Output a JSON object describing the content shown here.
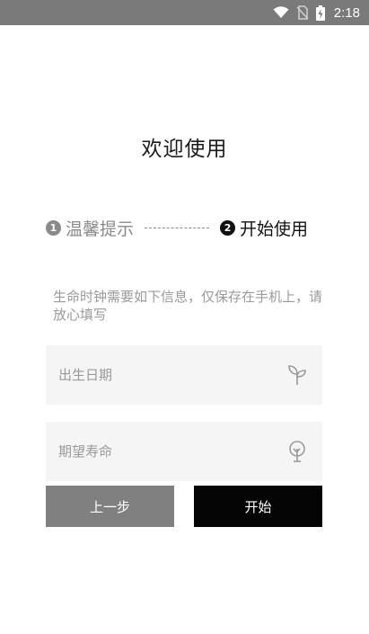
{
  "status_bar": {
    "time": "2:18",
    "icons": [
      "wifi-icon",
      "no-sim-icon",
      "battery-charging-icon"
    ]
  },
  "page": {
    "title": "欢迎使用"
  },
  "steps": [
    {
      "number": "1",
      "label": "温馨提示"
    },
    {
      "number": "2",
      "label": "开始使用"
    }
  ],
  "note": "生命时钟需要如下信息，仅保存在手机上，请放心填写",
  "fields": {
    "birth": {
      "placeholder": "出生日期",
      "value": "",
      "icon": "sprout-icon"
    },
    "life": {
      "placeholder": "期望寿命",
      "value": "",
      "icon": "tree-icon"
    }
  },
  "buttons": {
    "prev": "上一步",
    "start": "开始"
  },
  "colors": {
    "status_bar": "#7a7a7a",
    "field_bg": "#f5f5f5",
    "prev_button": "#808080",
    "start_button": "#050505",
    "muted_text": "#9a9a9a"
  }
}
